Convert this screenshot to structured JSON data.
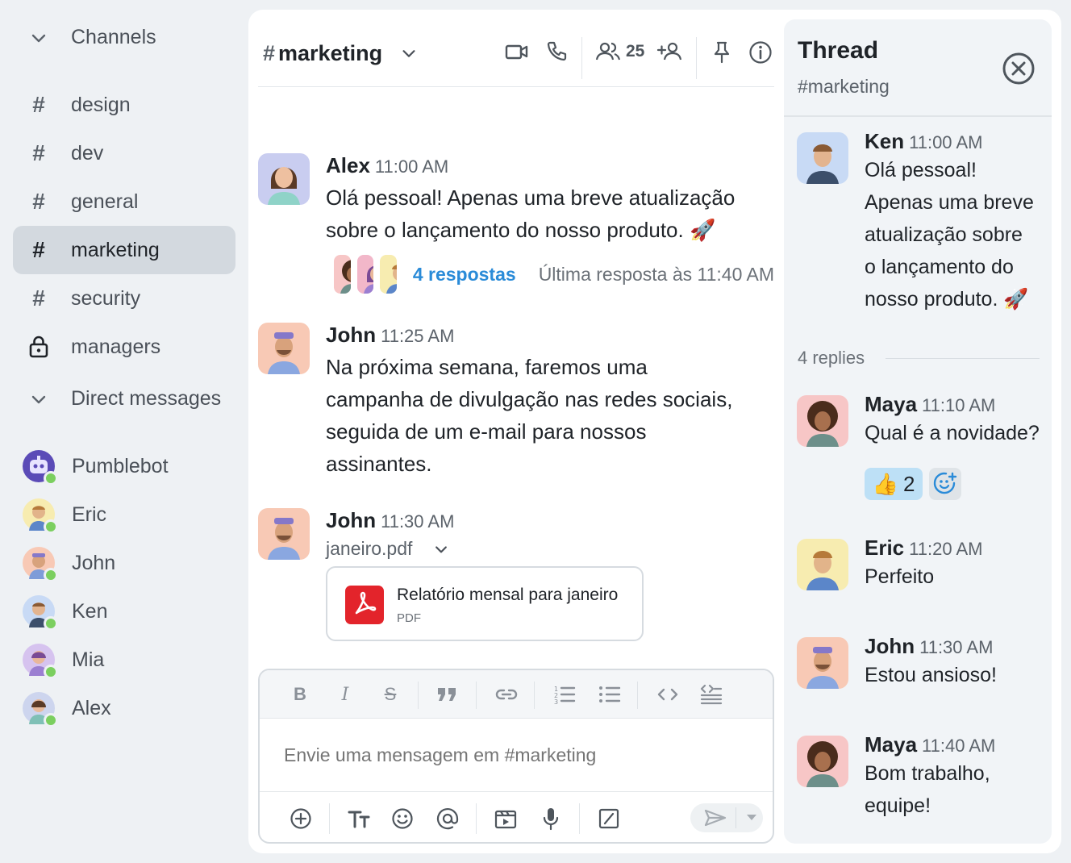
{
  "sidebar": {
    "channels_label": "Channels",
    "channels": [
      {
        "label": "design",
        "type": "public",
        "active": false
      },
      {
        "label": "dev",
        "type": "public",
        "active": false
      },
      {
        "label": "general",
        "type": "public",
        "active": false
      },
      {
        "label": "marketing",
        "type": "public",
        "active": true
      },
      {
        "label": "security",
        "type": "public",
        "active": false
      },
      {
        "label": "managers",
        "type": "private",
        "active": false
      }
    ],
    "dm_label": "Direct messages",
    "dms": [
      {
        "label": "Pumblebot",
        "avatar_color": "#5b4bb7",
        "online": true
      },
      {
        "label": "Eric",
        "avatar_color": "#f7ecb0",
        "online": true
      },
      {
        "label": "John",
        "avatar_color": "#f8c9b5",
        "online": true
      },
      {
        "label": "Ken",
        "avatar_color": "#c8daf5",
        "online": true
      },
      {
        "label": "Mia",
        "avatar_color": "#d6c3ef",
        "online": true
      },
      {
        "label": "Alex",
        "avatar_color": "#cdd5ee",
        "online": true
      }
    ]
  },
  "channel": {
    "hash": "#",
    "name": "marketing",
    "member_count": "25"
  },
  "messages": [
    {
      "author": "Alex",
      "time": "11:00 AM",
      "avatar_color": "#c9cdf0",
      "lines": [
        "Olá pessoal! Apenas uma breve atualização",
        "sobre o lançamento do nosso produto. 🚀"
      ],
      "replies_label": "4 respostas",
      "last_reply": "Última resposta às 11:40 AM"
    },
    {
      "author": "John",
      "time": "11:25 AM",
      "avatar_color": "#f8c9b5",
      "lines": [
        "Na próxima semana, faremos uma",
        "campanha de divulgação nas redes sociais,",
        "seguida de um e-mail para nossos",
        "assinantes."
      ]
    },
    {
      "author": "John",
      "time": "11:30 AM",
      "avatar_color": "#f8c9b5",
      "file_name": "janeiro.pdf",
      "file_title": "Relatório mensal para janeiro",
      "file_type": "PDF"
    }
  ],
  "composer": {
    "placeholder": "Envie uma mensagem em #marketing"
  },
  "thread": {
    "title": "Thread",
    "subtitle": "#marketing",
    "replies_label": "4 replies",
    "root": {
      "author": "Ken",
      "time": "11:00 AM",
      "avatar_color": "#c8daf5",
      "lines": [
        "Olá pessoal!",
        "Apenas uma breve",
        "atualização sobre",
        "o lançamento do",
        "nosso produto. 🚀"
      ]
    },
    "replies": [
      {
        "author": "Maya",
        "time": "11:10 AM",
        "avatar_color": "#f7c6c6",
        "lines": [
          "Qual é a novidade?"
        ],
        "reaction_emoji": "👍",
        "reaction_count": "2"
      },
      {
        "author": "Eric",
        "time": "11:20 AM",
        "avatar_color": "#f7ecb0",
        "lines": [
          "Perfeito"
        ]
      },
      {
        "author": "John",
        "time": "11:30 AM",
        "avatar_color": "#f8c9b5",
        "lines": [
          "Estou ansioso!"
        ]
      },
      {
        "author": "Maya",
        "time": "11:40 AM",
        "avatar_color": "#f7c6c6",
        "lines": [
          "Bom trabalho,",
          "equipe!"
        ]
      }
    ]
  },
  "colors": {
    "accent": "#2a8bd8",
    "online": "#7bcf5f",
    "pdf": "#e3242b",
    "active_channel_bg": "#d3d9df"
  }
}
